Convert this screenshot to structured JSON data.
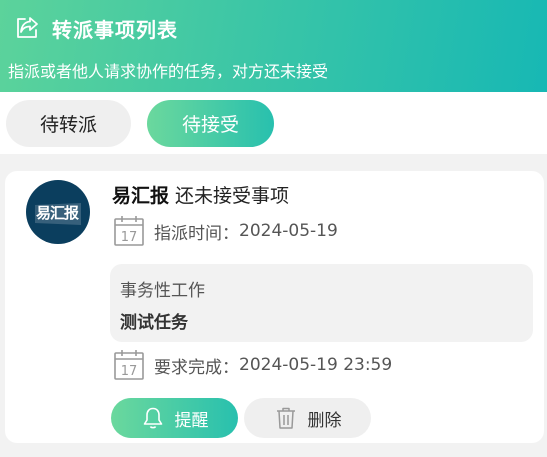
{
  "header": {
    "title": "转派事项列表",
    "subtitle": "指派或者他人请求协作的任务，对方还未接受",
    "icon": "share-icon"
  },
  "tabs": [
    {
      "label": "待转派",
      "active": false
    },
    {
      "label": "待接受",
      "active": true
    }
  ],
  "item": {
    "avatar_text": "易汇报",
    "user_name": "易汇报",
    "status_text": "还未接受事项",
    "assigned_label": "指派时间：",
    "assigned_date": "2024-05-19",
    "category": "事务性工作",
    "task_name": "测试任务",
    "due_label": "要求完成：",
    "due_datetime": "2024-05-19 23:59",
    "calendar_day": "17",
    "remind_label": "提醒",
    "delete_label": "删除"
  },
  "colors": {
    "accent_start": "#5cd39b",
    "accent_end": "#17b8b4",
    "avatar_bg": "#0b3e5e"
  }
}
